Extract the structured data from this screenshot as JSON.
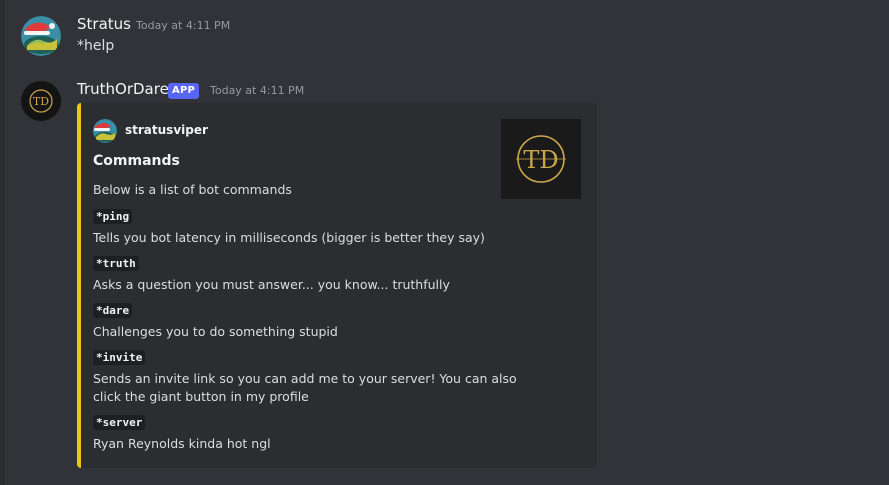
{
  "messages": [
    {
      "author": "Stratus",
      "timestamp": "Today at 4:11 PM",
      "content": "*help"
    },
    {
      "author": "TruthOrDare",
      "badge": "APP",
      "timestamp": "Today at 4:11 PM",
      "embed": {
        "accent_color": "#f0c419",
        "author_name": "stratusviper",
        "title": "Commands",
        "description": "Below is a list of bot commands",
        "thumbnail_monogram": "TD",
        "fields": [
          {
            "name": "*ping",
            "value_lines": [
              "Tells you bot latency in milliseconds (bigger is better they say)"
            ]
          },
          {
            "name": "*truth",
            "value_lines": [
              "Asks a question you must answer... you know... truthfully"
            ]
          },
          {
            "name": "*dare",
            "value_lines": [
              "Challenges you to do something stupid"
            ]
          },
          {
            "name": "*invite",
            "value_lines": [
              "Sends an invite link so you can add me to your server! You can also",
              "click the giant button in my profile"
            ]
          },
          {
            "name": "*server",
            "value_lines": [
              "Ryan Reynolds kinda hot ngl"
            ]
          }
        ]
      }
    }
  ],
  "colors": {
    "background": "#313338",
    "embed_background": "#2b2d31",
    "app_badge": "#5865f2",
    "timestamp": "#949ba4",
    "gold": "#c9a64a"
  },
  "icons": {
    "user_avatar": "dragon-santa-hat-avatar",
    "bot_avatar": "td-monogram-avatar"
  }
}
